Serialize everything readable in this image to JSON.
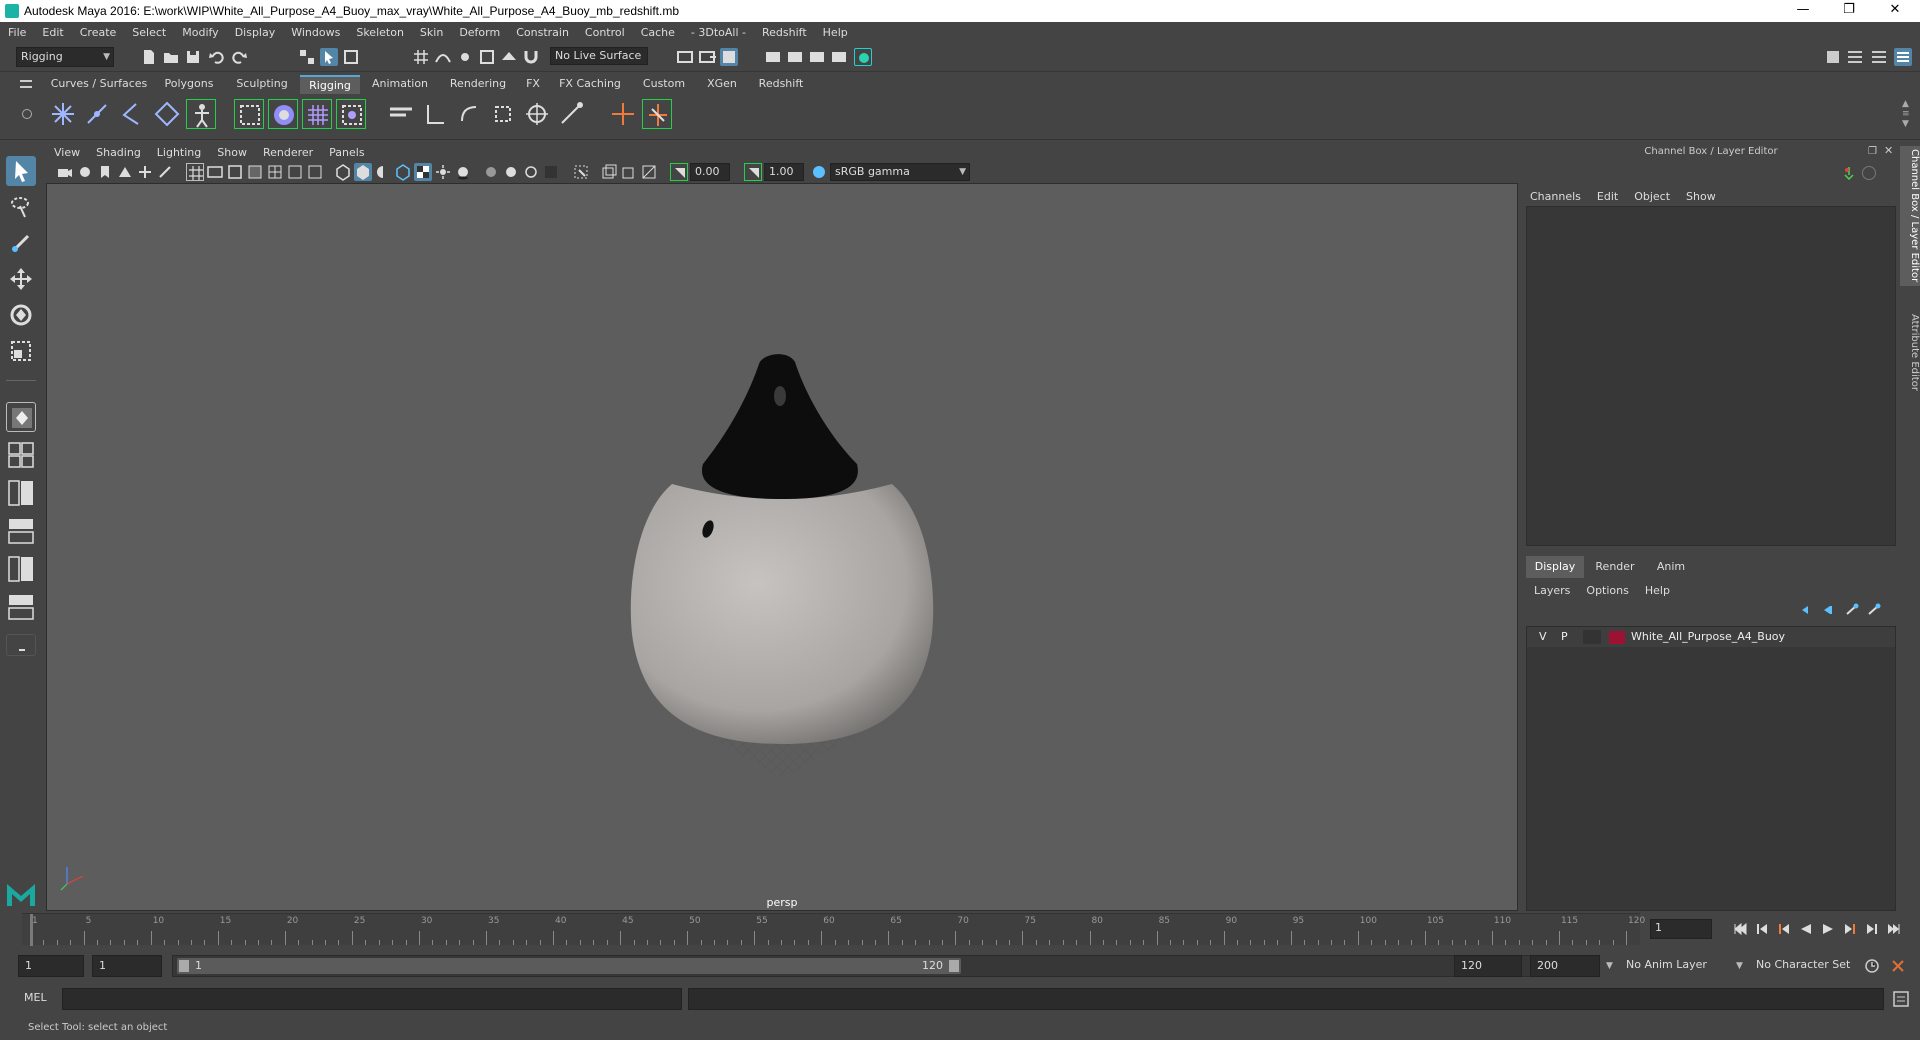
{
  "window": {
    "title": "Autodesk Maya 2016: E:\\work\\WIP\\White_All_Purpose_A4_Buoy_max_vray\\White_All_Purpose_A4_Buoy_mb_redshift.mb",
    "minimize": "—",
    "restore": "❐",
    "close": "✕"
  },
  "menu": [
    "File",
    "Edit",
    "Create",
    "Select",
    "Modify",
    "Display",
    "Windows",
    "Skeleton",
    "Skin",
    "Deform",
    "Constrain",
    "Control",
    "Cache",
    "- 3DtoAll -",
    "Redshift",
    "Help"
  ],
  "statusline": {
    "menuset": "Rigging",
    "live_surface": "No Live Surface"
  },
  "shelf": {
    "tabs": [
      "Curves / Surfaces",
      "Polygons",
      "Sculpting",
      "Rigging",
      "Animation",
      "Rendering",
      "FX",
      "FX Caching",
      "Custom",
      "XGen",
      "Redshift"
    ],
    "active_tab": "Rigging"
  },
  "viewport": {
    "menu": [
      "View",
      "Shading",
      "Lighting",
      "Show",
      "Renderer",
      "Panels"
    ],
    "exposure": "0.00",
    "gamma": "1.00",
    "color_space": "sRGB gamma",
    "camera": "persp"
  },
  "right_panel": {
    "header": "Channel Box / Layer Editor",
    "channel_menu": [
      "Channels",
      "Edit",
      "Object",
      "Show"
    ],
    "layer_tabs": [
      "Display",
      "Render",
      "Anim"
    ],
    "active_layer_tab": "Display",
    "layer_menu": [
      "Layers",
      "Options",
      "Help"
    ],
    "layers": [
      {
        "v": "V",
        "p": "P",
        "name": "White_All_Purpose_A4_Buoy",
        "color": "#9b1232"
      }
    ]
  },
  "side_tabs": [
    "Channel Box / Layer Editor",
    "Attribute Editor"
  ],
  "timeline": {
    "ticks": [
      "1",
      "5",
      "10",
      "15",
      "20",
      "25",
      "30",
      "35",
      "40",
      "45",
      "50",
      "55",
      "60",
      "65",
      "70",
      "75",
      "80",
      "85",
      "90",
      "95",
      "100",
      "105",
      "110",
      "115",
      "120"
    ],
    "current_frame": "1"
  },
  "range": {
    "start": "1",
    "playback_start": "1",
    "slider_start": "1",
    "slider_end": "120",
    "playback_end": "120",
    "end": "200",
    "anim_layer": "No Anim Layer",
    "character_set": "No Character Set"
  },
  "command_line": {
    "language": "MEL",
    "help_text": "Select Tool: select an object"
  }
}
